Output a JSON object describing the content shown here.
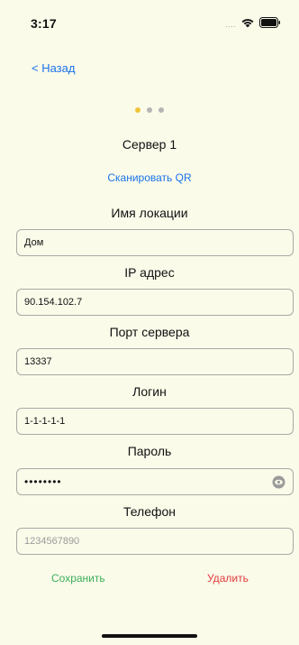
{
  "status_bar": {
    "time": "3:17",
    "signal": "....",
    "wifi_icon": "wifi-icon",
    "battery_icon": "battery-icon"
  },
  "nav": {
    "back_label": "< Назад"
  },
  "pager": {
    "pages": 3,
    "active_index": 0,
    "active_color": "#f0c43a",
    "inactive_color": "#b5b5b5"
  },
  "server": {
    "title": "Сервер 1",
    "scan_qr_label": "Сканировать QR"
  },
  "fields": {
    "location": {
      "label": "Имя локации",
      "value": "Дом"
    },
    "ip": {
      "label": "IP адрес",
      "value": "90.154.102.7"
    },
    "port": {
      "label": "Порт сервера",
      "value": "13337"
    },
    "login": {
      "label": "Логин",
      "value": "1-1-1-1-1"
    },
    "password": {
      "label": "Пароль",
      "value": "••••••••",
      "toggle_icon": "eye-icon"
    },
    "phone": {
      "label": "Телефон",
      "placeholder": "1234567890"
    }
  },
  "actions": {
    "save_label": "Сохранить",
    "delete_label": "Удалить",
    "save_color": "#3cae5a",
    "delete_color": "#e23b3b"
  },
  "colors": {
    "background": "#fbfbea",
    "link": "#1a73e8"
  }
}
